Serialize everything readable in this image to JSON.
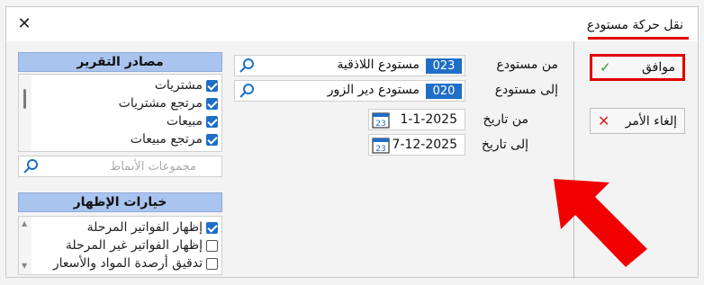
{
  "window": {
    "title": "نقل حركة مستودع",
    "close_glyph": "✕"
  },
  "buttons": {
    "ok": {
      "label": "موافق",
      "icon": "check-icon"
    },
    "cancel": {
      "label": "إلغاء الأمر",
      "icon": "x-icon"
    }
  },
  "fields": {
    "from_warehouse": {
      "label": "من مستودع",
      "code": "023",
      "name": "مستودع اللاذقية"
    },
    "to_warehouse": {
      "label": "إلى مستودع",
      "code": "020",
      "name": "مستودع دير الزور"
    },
    "from_date": {
      "label": "من تاريخ",
      "value": "1-1-2025"
    },
    "to_date": {
      "label": "إلى تاريخ",
      "value": "7-12-2025"
    }
  },
  "report_sources": {
    "title": "مصادر التقرير",
    "items": [
      {
        "label": "مشتريات",
        "checked": true
      },
      {
        "label": "مرتجع مشتريات",
        "checked": true
      },
      {
        "label": "مبيعات",
        "checked": true
      },
      {
        "label": "مرتجع مبيعات",
        "checked": true
      }
    ],
    "patterns_placeholder": "مجموعات الأنماط"
  },
  "display_options": {
    "title": "خيارات الإظهار",
    "items": [
      {
        "label": "إظهار الفواتير المرحلة",
        "checked": true
      },
      {
        "label": "إظهار الفواتير غير المرحلة",
        "checked": false
      },
      {
        "label": "تدقيق أرصدة المواد والأسعار",
        "checked": false
      }
    ]
  },
  "colors": {
    "accent": "#1f6fc7",
    "highlight": "#e00000",
    "panel_header": "#a9c4ee"
  }
}
